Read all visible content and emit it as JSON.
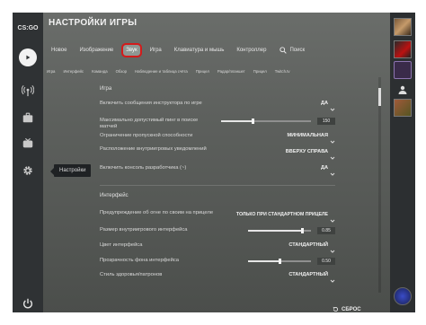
{
  "app": {
    "logo": "CS:GO",
    "title": "НАСТРОЙКИ ИГРЫ"
  },
  "nav": {
    "items": [
      "Новое",
      "Изображение",
      "Звук",
      "Игра",
      "Клавиатура и мышь",
      "Контроллер"
    ],
    "active": "Звук",
    "search": "Поиск"
  },
  "subnav": [
    "Игра",
    "Интерфейс",
    "Команда",
    "Обзор",
    "Наблюдение и таблица счёта",
    "Прицел",
    "Радар/планшет",
    "Прицел",
    "Twitch.tv"
  ],
  "tooltip": "Настройки",
  "sections": {
    "game": "Игра",
    "interface": "Интерфейс"
  },
  "settings": {
    "instructor": {
      "label": "Включить сообщения инструктора по игре",
      "value": "ДА"
    },
    "ping": {
      "label": "Максимально допустимый пинг в поиске матчей",
      "value": "150",
      "level": 0.35
    },
    "bandwidth": {
      "label": "Ограничение пропускной способности",
      "value": "МИНИМАЛЬНАЯ"
    },
    "notif_pos": {
      "label": "Расположение внутриигровых уведомлений",
      "value": "ВВЕРХУ СПРАВА"
    },
    "console": {
      "label": "Включить консоль разработчика (~)",
      "value": "ДА"
    },
    "fire_warning": {
      "label": "Предупреждение об огне по своим на прицеле",
      "value": "ТОЛЬКО ПРИ СТАНДАРТНОМ ПРИЦЕЛЕ"
    },
    "hud_scale": {
      "label": "Размер внутриигрового интерфейса",
      "value": "0.85",
      "level": 0.85
    },
    "hud_color": {
      "label": "Цвет интерфейса",
      "value": "СТАНДАРТНЫЙ"
    },
    "hud_alpha": {
      "label": "Прозрачность фона интерфейса",
      "value": "0.50",
      "level": 0.5
    },
    "health_style": {
      "label": "Стиль здоровья/патронов",
      "value": "СТАНДАРТНЫЙ"
    }
  },
  "footer": {
    "reset": "СБРОС"
  }
}
